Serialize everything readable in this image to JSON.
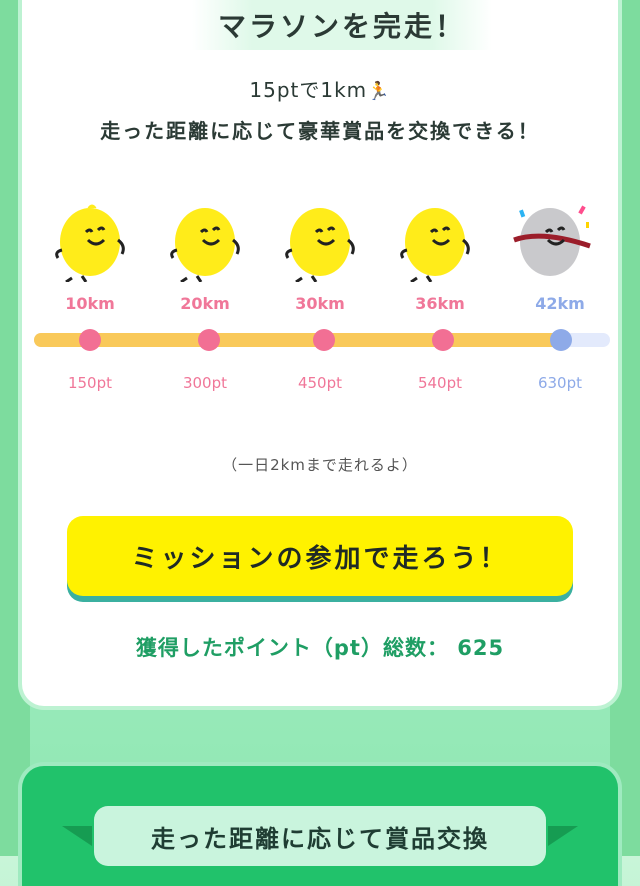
{
  "header": {
    "title": "マラソンを完走！"
  },
  "intro": {
    "rate_text": "15ptで1km",
    "runner_emoji": "🏃",
    "description": "走った距離に応じて豪華賞品を交換できる！"
  },
  "milestones": [
    {
      "km": "10km",
      "pt": "150pt"
    },
    {
      "km": "20km",
      "pt": "300pt"
    },
    {
      "km": "30km",
      "pt": "450pt"
    },
    {
      "km": "36km",
      "pt": "540pt"
    },
    {
      "km": "42km",
      "pt": "630pt"
    }
  ],
  "progress": {
    "fraction": 0.93
  },
  "note": "（一日2kmまで走れるよ）",
  "cta": {
    "label": "ミッションの参加で走ろう！"
  },
  "points": {
    "label": "獲得したポイント（pt）総数：",
    "value": "625"
  },
  "exchange": {
    "title": "走った距離に応じて賞品交換"
  },
  "colors": {
    "accent_pink": "#f26f94",
    "goal_blue": "#8eaae8",
    "track_yellow": "#f9c95a",
    "cta_yellow": "#fff200",
    "points_green": "#1f9e64",
    "exchange_green": "#21c26b",
    "mascot_yellow": "#ffec1a",
    "mascot_gray": "#c9c9cc"
  }
}
